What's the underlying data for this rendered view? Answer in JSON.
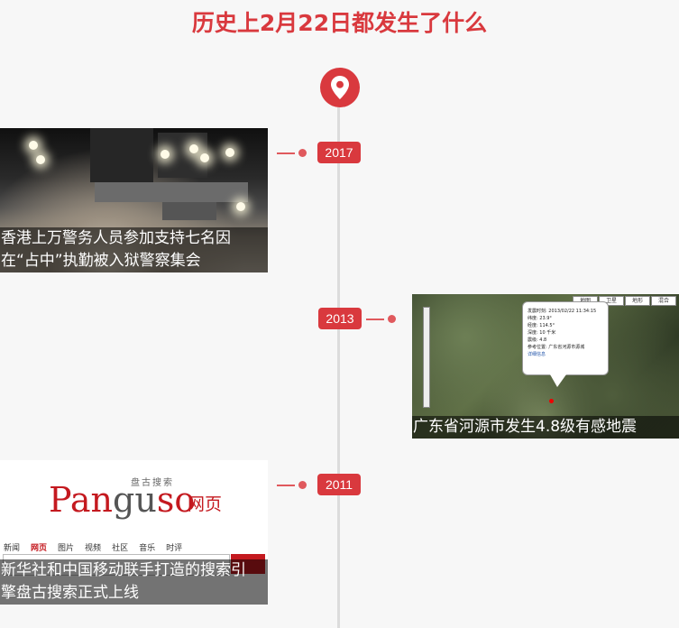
{
  "page": {
    "title": "历史上2月22日都发生了什么"
  },
  "colors": {
    "accent": "#d9393e",
    "line": "#dcdcdc",
    "background": "#f7f7f7"
  },
  "icons": {
    "pin": "map-pin-icon"
  },
  "events": [
    {
      "year": "2017",
      "caption": "香港上万警务人员参加支持七名因\n在“占中”执勤被入狱警察集会"
    },
    {
      "year": "2013",
      "caption": "广东省河源市发生4.8级有感地震",
      "map": {
        "toolbar": [
          "地图",
          "卫星",
          "地形",
          "混合"
        ],
        "popup": [
          "发震时刻: 2013/02/22 11:34:15",
          "纬度: 23.9°",
          "经度: 114.5°",
          "深度: 10 千米",
          "震级: 4.8",
          "参考位置: 广东省河源市源城"
        ],
        "popup_link": "详细信息"
      }
    },
    {
      "year": "2011",
      "caption": "新华社和中国移动联手打造的搜索引\n擎盘古搜索正式上线",
      "logo": {
        "top": "盘古搜索",
        "word_red": "Pan",
        "word_gray": "gu",
        "word_red2": "so",
        "suffix": "网页"
      },
      "nav": [
        "新闻",
        "网页",
        "图片",
        "视频",
        "社区",
        "音乐",
        "时评"
      ],
      "nav_active": "网页"
    }
  ]
}
